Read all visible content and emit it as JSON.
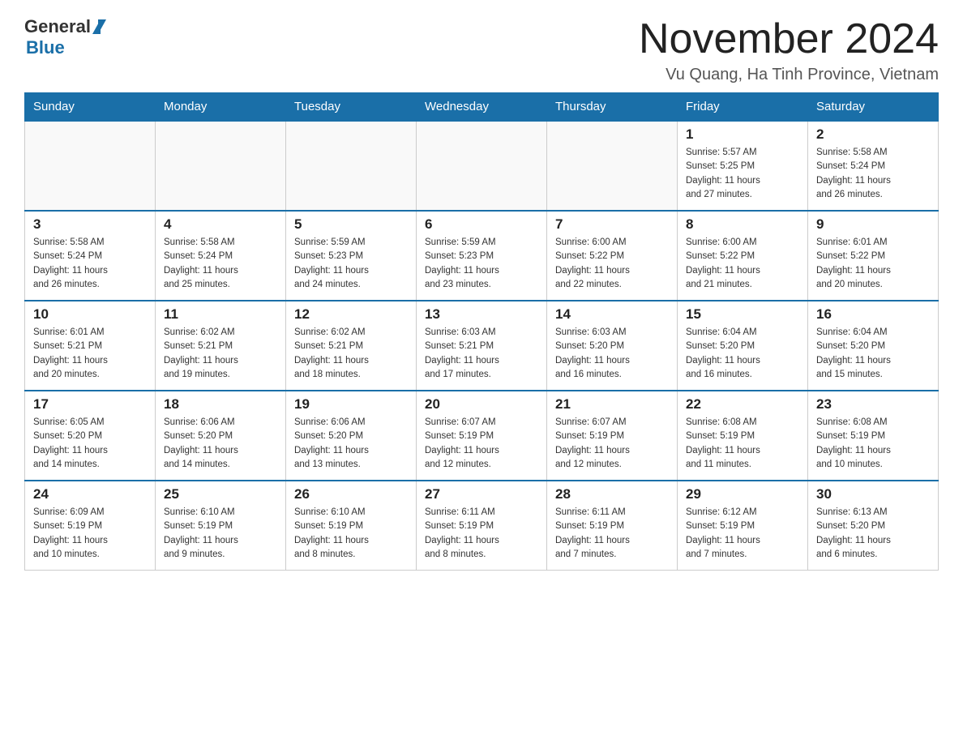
{
  "header": {
    "logo_general": "General",
    "logo_blue": "Blue",
    "month_title": "November 2024",
    "location": "Vu Quang, Ha Tinh Province, Vietnam"
  },
  "weekdays": [
    "Sunday",
    "Monday",
    "Tuesday",
    "Wednesday",
    "Thursday",
    "Friday",
    "Saturday"
  ],
  "weeks": [
    [
      {
        "day": "",
        "info": ""
      },
      {
        "day": "",
        "info": ""
      },
      {
        "day": "",
        "info": ""
      },
      {
        "day": "",
        "info": ""
      },
      {
        "day": "",
        "info": ""
      },
      {
        "day": "1",
        "info": "Sunrise: 5:57 AM\nSunset: 5:25 PM\nDaylight: 11 hours\nand 27 minutes."
      },
      {
        "day": "2",
        "info": "Sunrise: 5:58 AM\nSunset: 5:24 PM\nDaylight: 11 hours\nand 26 minutes."
      }
    ],
    [
      {
        "day": "3",
        "info": "Sunrise: 5:58 AM\nSunset: 5:24 PM\nDaylight: 11 hours\nand 26 minutes."
      },
      {
        "day": "4",
        "info": "Sunrise: 5:58 AM\nSunset: 5:24 PM\nDaylight: 11 hours\nand 25 minutes."
      },
      {
        "day": "5",
        "info": "Sunrise: 5:59 AM\nSunset: 5:23 PM\nDaylight: 11 hours\nand 24 minutes."
      },
      {
        "day": "6",
        "info": "Sunrise: 5:59 AM\nSunset: 5:23 PM\nDaylight: 11 hours\nand 23 minutes."
      },
      {
        "day": "7",
        "info": "Sunrise: 6:00 AM\nSunset: 5:22 PM\nDaylight: 11 hours\nand 22 minutes."
      },
      {
        "day": "8",
        "info": "Sunrise: 6:00 AM\nSunset: 5:22 PM\nDaylight: 11 hours\nand 21 minutes."
      },
      {
        "day": "9",
        "info": "Sunrise: 6:01 AM\nSunset: 5:22 PM\nDaylight: 11 hours\nand 20 minutes."
      }
    ],
    [
      {
        "day": "10",
        "info": "Sunrise: 6:01 AM\nSunset: 5:21 PM\nDaylight: 11 hours\nand 20 minutes."
      },
      {
        "day": "11",
        "info": "Sunrise: 6:02 AM\nSunset: 5:21 PM\nDaylight: 11 hours\nand 19 minutes."
      },
      {
        "day": "12",
        "info": "Sunrise: 6:02 AM\nSunset: 5:21 PM\nDaylight: 11 hours\nand 18 minutes."
      },
      {
        "day": "13",
        "info": "Sunrise: 6:03 AM\nSunset: 5:21 PM\nDaylight: 11 hours\nand 17 minutes."
      },
      {
        "day": "14",
        "info": "Sunrise: 6:03 AM\nSunset: 5:20 PM\nDaylight: 11 hours\nand 16 minutes."
      },
      {
        "day": "15",
        "info": "Sunrise: 6:04 AM\nSunset: 5:20 PM\nDaylight: 11 hours\nand 16 minutes."
      },
      {
        "day": "16",
        "info": "Sunrise: 6:04 AM\nSunset: 5:20 PM\nDaylight: 11 hours\nand 15 minutes."
      }
    ],
    [
      {
        "day": "17",
        "info": "Sunrise: 6:05 AM\nSunset: 5:20 PM\nDaylight: 11 hours\nand 14 minutes."
      },
      {
        "day": "18",
        "info": "Sunrise: 6:06 AM\nSunset: 5:20 PM\nDaylight: 11 hours\nand 14 minutes."
      },
      {
        "day": "19",
        "info": "Sunrise: 6:06 AM\nSunset: 5:20 PM\nDaylight: 11 hours\nand 13 minutes."
      },
      {
        "day": "20",
        "info": "Sunrise: 6:07 AM\nSunset: 5:19 PM\nDaylight: 11 hours\nand 12 minutes."
      },
      {
        "day": "21",
        "info": "Sunrise: 6:07 AM\nSunset: 5:19 PM\nDaylight: 11 hours\nand 12 minutes."
      },
      {
        "day": "22",
        "info": "Sunrise: 6:08 AM\nSunset: 5:19 PM\nDaylight: 11 hours\nand 11 minutes."
      },
      {
        "day": "23",
        "info": "Sunrise: 6:08 AM\nSunset: 5:19 PM\nDaylight: 11 hours\nand 10 minutes."
      }
    ],
    [
      {
        "day": "24",
        "info": "Sunrise: 6:09 AM\nSunset: 5:19 PM\nDaylight: 11 hours\nand 10 minutes."
      },
      {
        "day": "25",
        "info": "Sunrise: 6:10 AM\nSunset: 5:19 PM\nDaylight: 11 hours\nand 9 minutes."
      },
      {
        "day": "26",
        "info": "Sunrise: 6:10 AM\nSunset: 5:19 PM\nDaylight: 11 hours\nand 8 minutes."
      },
      {
        "day": "27",
        "info": "Sunrise: 6:11 AM\nSunset: 5:19 PM\nDaylight: 11 hours\nand 8 minutes."
      },
      {
        "day": "28",
        "info": "Sunrise: 6:11 AM\nSunset: 5:19 PM\nDaylight: 11 hours\nand 7 minutes."
      },
      {
        "day": "29",
        "info": "Sunrise: 6:12 AM\nSunset: 5:19 PM\nDaylight: 11 hours\nand 7 minutes."
      },
      {
        "day": "30",
        "info": "Sunrise: 6:13 AM\nSunset: 5:20 PM\nDaylight: 11 hours\nand 6 minutes."
      }
    ]
  ]
}
